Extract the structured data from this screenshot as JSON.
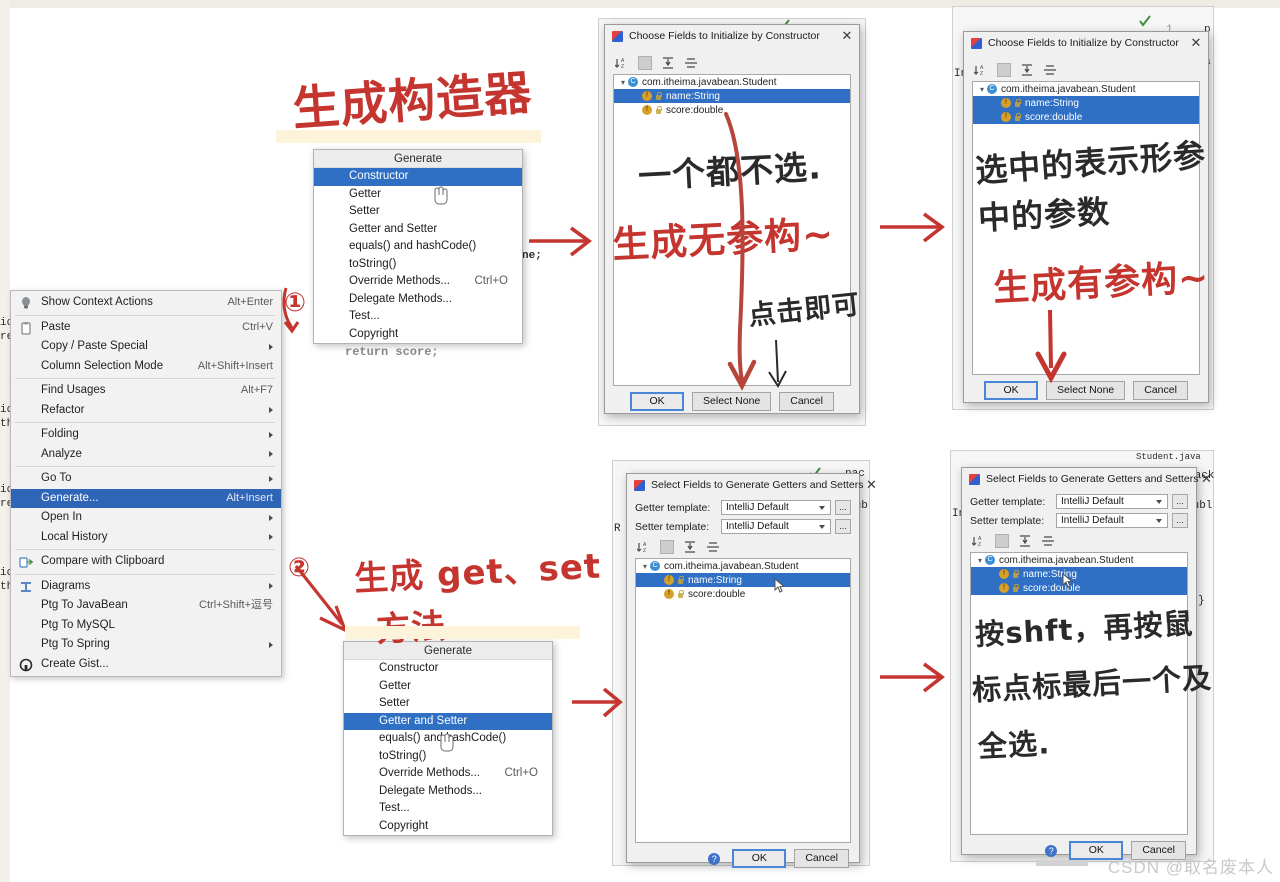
{
  "watermark": "CSDN @取名废本人",
  "context_menu": {
    "name": "editor-context-menu",
    "items": [
      {
        "label": "Show Context Actions",
        "accel": "Alt+Enter",
        "icon": "lightbulb-icon",
        "submenu": false,
        "selected": false
      },
      {
        "sep": true
      },
      {
        "label": "Paste",
        "accel": "Ctrl+V",
        "icon": "clipboard-icon",
        "submenu": false,
        "selected": false
      },
      {
        "label": "Copy / Paste Special",
        "accel": "",
        "icon": "",
        "submenu": true,
        "selected": false
      },
      {
        "label": "Column Selection Mode",
        "accel": "Alt+Shift+Insert",
        "icon": "",
        "submenu": false,
        "selected": false
      },
      {
        "sep": true
      },
      {
        "label": "Find Usages",
        "accel": "Alt+F7",
        "icon": "",
        "submenu": false,
        "selected": false
      },
      {
        "label": "Refactor",
        "accel": "",
        "icon": "",
        "submenu": true,
        "selected": false
      },
      {
        "sep": true
      },
      {
        "label": "Folding",
        "accel": "",
        "icon": "",
        "submenu": true,
        "selected": false
      },
      {
        "label": "Analyze",
        "accel": "",
        "icon": "",
        "submenu": true,
        "selected": false
      },
      {
        "sep": true
      },
      {
        "label": "Go To",
        "accel": "",
        "icon": "",
        "submenu": true,
        "selected": false
      },
      {
        "label": "Generate...",
        "accel": "Alt+Insert",
        "icon": "",
        "submenu": false,
        "selected": true
      },
      {
        "label": "Open In",
        "accel": "",
        "icon": "",
        "submenu": true,
        "selected": false
      },
      {
        "label": "Local History",
        "accel": "",
        "icon": "",
        "submenu": true,
        "selected": false
      },
      {
        "sep": true
      },
      {
        "label": "Compare with Clipboard",
        "accel": "",
        "icon": "compare-icon",
        "submenu": false,
        "selected": false
      },
      {
        "sep": true
      },
      {
        "label": "Diagrams",
        "accel": "",
        "icon": "diagram-icon",
        "submenu": true,
        "selected": false
      },
      {
        "label": "Ptg To JavaBean",
        "accel": "Ctrl+Shift+逗号",
        "icon": "",
        "submenu": false,
        "selected": false
      },
      {
        "label": "Ptg To MySQL",
        "accel": "",
        "icon": "",
        "submenu": false,
        "selected": false
      },
      {
        "label": "Ptg To Spring",
        "accel": "",
        "icon": "",
        "submenu": true,
        "selected": false
      },
      {
        "label": "Create Gist...",
        "accel": "",
        "icon": "github-icon",
        "submenu": false,
        "selected": false
      }
    ]
  },
  "generate_menu_top": {
    "title": "Generate",
    "items": [
      {
        "label": "Constructor",
        "accel": "",
        "selected": true
      },
      {
        "label": "Getter",
        "accel": "",
        "selected": false
      },
      {
        "label": "Setter",
        "accel": "",
        "selected": false
      },
      {
        "label": "Getter and Setter",
        "accel": "",
        "selected": false
      },
      {
        "label": "equals() and hashCode()",
        "accel": "",
        "selected": false
      },
      {
        "label": "toString()",
        "accel": "",
        "selected": false
      },
      {
        "label": "Override Methods...",
        "accel": "Ctrl+O",
        "selected": false
      },
      {
        "label": "Delegate Methods...",
        "accel": "",
        "selected": false
      },
      {
        "label": "Test...",
        "accel": "",
        "selected": false
      },
      {
        "label": "Copyright",
        "accel": "",
        "selected": false
      }
    ]
  },
  "generate_menu_bottom": {
    "title": "Generate",
    "items": [
      {
        "label": "Constructor",
        "accel": "",
        "selected": false
      },
      {
        "label": "Getter",
        "accel": "",
        "selected": false
      },
      {
        "label": "Setter",
        "accel": "",
        "selected": false
      },
      {
        "label": "Getter and Setter",
        "accel": "",
        "selected": true
      },
      {
        "label": "equals() and hashCode()",
        "accel": "",
        "selected": false
      },
      {
        "label": "toString()",
        "accel": "",
        "selected": false
      },
      {
        "label": "Override Methods...",
        "accel": "Ctrl+O",
        "selected": false
      },
      {
        "label": "Delegate Methods...",
        "accel": "",
        "selected": false
      },
      {
        "label": "Test...",
        "accel": "",
        "selected": false
      },
      {
        "label": "Copyright",
        "accel": "",
        "selected": false
      }
    ]
  },
  "dialog_ctor_none": {
    "title": "Choose Fields to Initialize by Constructor",
    "close": "✕",
    "tree": {
      "root": "com.itheima.javabean.Student",
      "fields": [
        {
          "label": "name:String",
          "selected": true
        },
        {
          "label": "score:double",
          "selected": false
        }
      ]
    },
    "buttons": {
      "ok": "OK",
      "select_none": "Select None",
      "cancel": "Cancel",
      "default": "OK"
    }
  },
  "dialog_ctor_all": {
    "title": "Choose Fields to Initialize by Constructor",
    "close": "✕",
    "tree": {
      "root": "com.itheima.javabean.Student",
      "fields": [
        {
          "label": "name:String",
          "selected": true
        },
        {
          "label": "score:double",
          "selected": true
        }
      ]
    },
    "buttons": {
      "ok": "OK",
      "select_none": "Select None",
      "cancel": "Cancel",
      "default": "OK"
    }
  },
  "dialog_gs_one": {
    "title": "Select Fields to Generate Getters and Setters",
    "close": "✕",
    "getter_template_label": "Getter template:",
    "getter_template_value": "IntelliJ Default",
    "setter_template_label": "Setter template:",
    "setter_template_value": "IntelliJ Default",
    "ellipsis": "...",
    "tree": {
      "root": "com.itheima.javabean.Student",
      "fields": [
        {
          "label": "name:String",
          "selected": true
        },
        {
          "label": "score:double",
          "selected": false
        }
      ]
    },
    "buttons": {
      "ok": "OK",
      "cancel": "Cancel",
      "help": "?"
    }
  },
  "dialog_gs_all": {
    "title": "Select Fields to Generate Getters and Setters",
    "close": "✕",
    "getter_template_label": "Getter template:",
    "getter_template_value": "IntelliJ Default",
    "setter_template_label": "Setter template:",
    "setter_template_value": "IntelliJ Default",
    "ellipsis": "...",
    "tree": {
      "root": "com.itheima.javabean.Student",
      "fields": [
        {
          "label": "name:String",
          "selected": true
        },
        {
          "label": "score:double",
          "selected": true
        }
      ]
    },
    "buttons": {
      "ok": "OK",
      "cancel": "Cancel",
      "help": "?"
    }
  },
  "annotations": {
    "title_generate_constructor": "生成构造器",
    "step_one": "①",
    "step_two": "②",
    "no_select": "一个都不选.",
    "gen_noarg_ctor": "生成无参构~",
    "click_ok": "点击即可",
    "selected_means_params_line1": "选中的表示形参",
    "selected_means_params_line2": "中的参数",
    "gen_arg_ctor": "生成有参构~",
    "gen_get_set_line1": "生成 get、set",
    "gen_get_set_line2": "方法.",
    "shift_tip_line1": "按shft，再按鼠",
    "shift_tip_line2": "标点标最后一个及",
    "shift_tip_line3": "全选."
  },
  "editor_bits": {
    "frag_name": "ne;",
    "frag_return_score": "return score;",
    "pack": "pack",
    "publ": "publ",
    "oub": "oub",
    "tab_student": "Student.java",
    "gutter_1": "1",
    "left_code": [
      "ic",
      "re",
      "ic",
      "th",
      "ic",
      "re",
      "ic",
      "th"
    ]
  },
  "colors": {
    "selection_blue": "#2f6fc4",
    "menu_selection": "#2f65b7",
    "red_ink": "#c5352f",
    "black_ink": "#2a2a2a",
    "dialog_bg": "#f0f0f0"
  }
}
